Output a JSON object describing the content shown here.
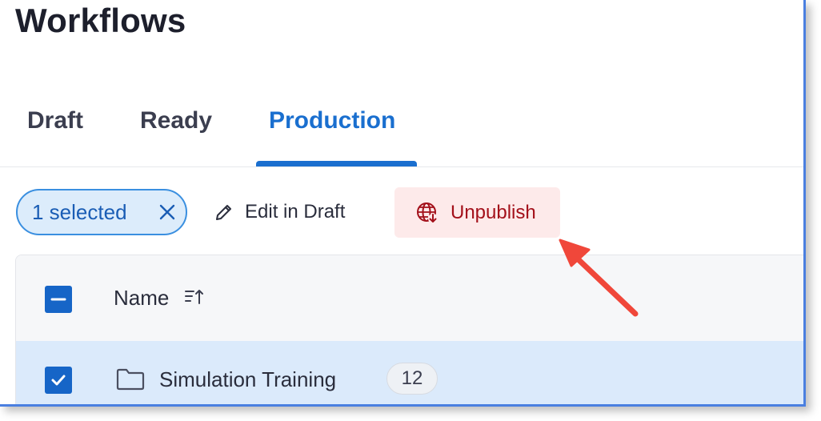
{
  "page": {
    "title": "Workflows"
  },
  "tabs": [
    {
      "label": "Draft",
      "active": false
    },
    {
      "label": "Ready",
      "active": false
    },
    {
      "label": "Production",
      "active": true
    }
  ],
  "toolbar": {
    "selected_label": "1 selected",
    "edit_label": "Edit in Draft",
    "unpublish_label": "Unpublish"
  },
  "table": {
    "columns": [
      {
        "label": "Name",
        "sort": "ascending"
      }
    ],
    "rows": [
      {
        "name": "Simulation Training",
        "count": "12",
        "checked": true,
        "type": "folder"
      }
    ]
  },
  "colors": {
    "accent": "#1a6fcf",
    "checkbox": "#1665c7",
    "unpublish_bg": "#fdeaea",
    "unpublish_text": "#a3101a",
    "row_selected": "#dbeafb",
    "annotation_arrow": "#f0473a"
  },
  "icons": [
    "close-icon",
    "pencil-icon",
    "globe-download-icon",
    "sort-ascending-icon",
    "folder-icon",
    "checkmark-icon",
    "minus-icon",
    "arrow-annotation"
  ]
}
